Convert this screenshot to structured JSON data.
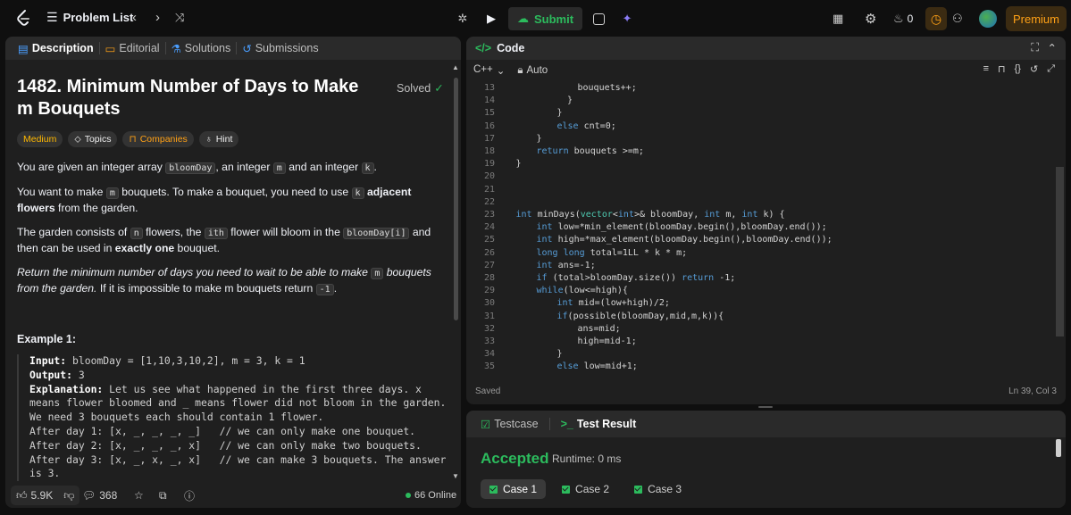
{
  "topbar": {
    "problem_list": "Problem List",
    "submit_label": "Submit",
    "fire_count": "0",
    "premium_label": "Premium"
  },
  "left_tabs": [
    "Description",
    "Editorial",
    "Solutions",
    "Submissions"
  ],
  "problem": {
    "title": "1482. Minimum Number of Days to Make m Bouquets",
    "status": "Solved",
    "difficulty": "Medium",
    "chips": [
      "Topics",
      "Companies",
      "Hint"
    ]
  },
  "description": {
    "p1_a": "You are given an integer array ",
    "p1_code1": "bloomDay",
    "p1_b": ", an integer ",
    "p1_code2": "m",
    "p1_c": " and an integer ",
    "p1_code3": "k",
    "p1_d": ".",
    "p2_a": "You want to make ",
    "p2_code1": "m",
    "p2_b": " bouquets. To make a bouquet, you need to use ",
    "p2_code2": "k",
    "p2_bold": "adjacent flowers",
    "p2_c": " from the garden.",
    "p3_a": "The garden consists of ",
    "p3_code1": "n",
    "p3_b": " flowers, the ",
    "p3_code2": "ith",
    "p3_c": " flower will bloom in the ",
    "p3_code3": "bloomDay[i]",
    "p3_d": " and then can be used in ",
    "p3_bold": "exactly one",
    "p3_e": " bouquet.",
    "p4_italic": "Return the minimum number of days you need to wait to be able to make ",
    "p4_code1": "m",
    "p4_italic2": " bouquets from the garden.",
    "p4_b": " If it is impossible to make m bouquets return ",
    "p4_code2": "-1",
    "p4_c": "."
  },
  "example": {
    "title": "Example 1:",
    "input_label": "Input:",
    "input_value": " bloomDay = [1,10,3,10,2], m = 3, k = 1",
    "output_label": "Output:",
    "output_value": " 3",
    "explanation_label": "Explanation:",
    "explanation_lines": [
      " Let us see what happened in the first three days. x",
      "means flower bloomed and _ means flower did not bloom in the garden.",
      "We need 3 bouquets each should contain 1 flower.",
      "After day 1: [x, _, _, _, _]   // we can only make one bouquet.",
      "After day 2: [x, _, _, _, x]   // we can only make two bouquets.",
      "After day 3: [x, _, x, _, x]   // we can make 3 bouquets. The answer",
      "is 3."
    ]
  },
  "left_footer": {
    "likes": "5.9K",
    "comments": "368",
    "online": "66 Online"
  },
  "code_panel": {
    "title": "Code",
    "language": "C++",
    "mode": "Auto",
    "saved": "Saved",
    "cursor": "Ln 39, Col 3"
  },
  "code_lines": [
    {
      "n": "13",
      "indent": 7,
      "text": "bouquets++;"
    },
    {
      "n": "14",
      "indent": 6,
      "text": "}"
    },
    {
      "n": "15",
      "indent": 5,
      "text": "}"
    },
    {
      "n": "16",
      "indent": 5,
      "text": "else cnt=0;"
    },
    {
      "n": "17",
      "indent": 3,
      "text": "}"
    },
    {
      "n": "18",
      "indent": 3,
      "text": "return bouquets >=m;"
    },
    {
      "n": "19",
      "indent": 1,
      "text": "}"
    },
    {
      "n": "20",
      "indent": 0,
      "text": ""
    },
    {
      "n": "21",
      "indent": 0,
      "text": ""
    },
    {
      "n": "22",
      "indent": 0,
      "text": ""
    },
    {
      "n": "23",
      "indent": 1,
      "text": "int minDays(vector<int>& bloomDay, int m, int k) {"
    },
    {
      "n": "24",
      "indent": 3,
      "text": "int low=*min_element(bloomDay.begin(),bloomDay.end());"
    },
    {
      "n": "25",
      "indent": 3,
      "text": "int high=*max_element(bloomDay.begin(),bloomDay.end());"
    },
    {
      "n": "26",
      "indent": 3,
      "text": "long long total=1LL * k * m;"
    },
    {
      "n": "27",
      "indent": 3,
      "text": "int ans=-1;"
    },
    {
      "n": "28",
      "indent": 3,
      "text": "if (total>bloomDay.size()) return -1;"
    },
    {
      "n": "29",
      "indent": 3,
      "text": "while(low<=high){"
    },
    {
      "n": "30",
      "indent": 5,
      "text": "int mid=(low+high)/2;"
    },
    {
      "n": "31",
      "indent": 5,
      "text": "if(possible(bloomDay,mid,m,k)){"
    },
    {
      "n": "32",
      "indent": 7,
      "text": "ans=mid;"
    },
    {
      "n": "33",
      "indent": 7,
      "text": "high=mid-1;"
    },
    {
      "n": "34",
      "indent": 5,
      "text": "}"
    },
    {
      "n": "35",
      "indent": 5,
      "text": "else low=mid+1;"
    }
  ],
  "test_panel": {
    "tabs": [
      "Testcase",
      "Test Result"
    ],
    "result": "Accepted",
    "runtime": "Runtime: 0 ms",
    "cases": [
      "Case 1",
      "Case 2",
      "Case 3"
    ]
  },
  "colors": {
    "accent_green": "#2cbb5d",
    "premium_orange": "#ffa116",
    "medium_yellow": "#ffb800",
    "panel_bg": "#1f1f1f"
  }
}
